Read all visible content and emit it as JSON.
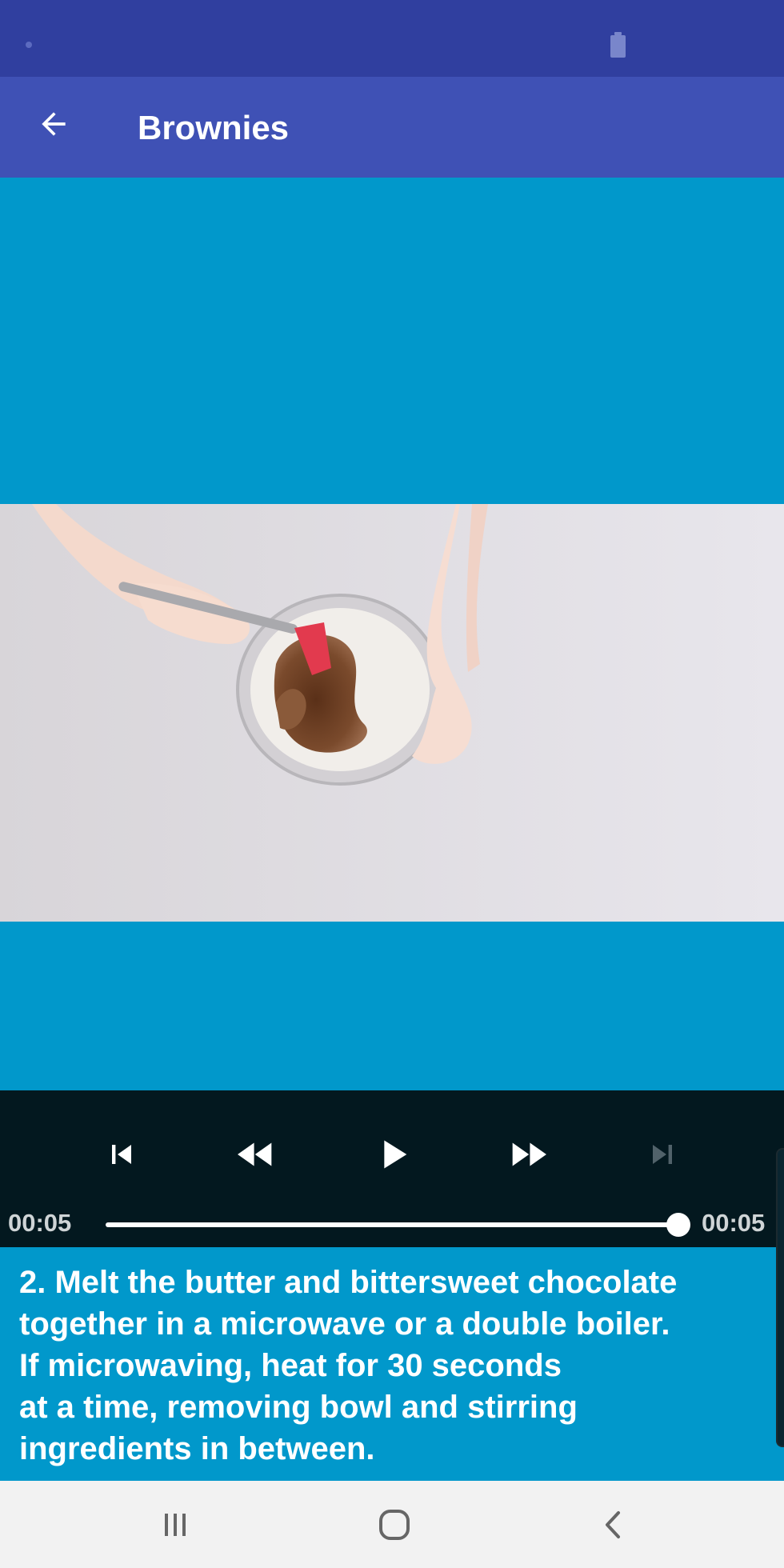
{
  "app": {
    "title": "Brownies"
  },
  "player": {
    "current_time": "00:05",
    "duration": "00:05",
    "progress": 1.0,
    "state": "paused",
    "next_disabled": true
  },
  "step": {
    "text": "2. Melt the butter and bittersweet chocolate\ntogether in a microwave or a double boiler.\nIf microwaving, heat for 30 seconds\nat a time, removing bowl and stirring\ningredients in between."
  },
  "icons": {
    "back": "arrow-left-icon",
    "previous": "skip-previous-icon",
    "rewind": "rewind-icon",
    "play": "play-icon",
    "forward": "fast-forward-icon",
    "next": "skip-next-icon",
    "recents": "recent-apps-icon",
    "home": "home-icon",
    "nav_back": "chevron-left-icon"
  },
  "colors": {
    "status_bar": "#303f9f",
    "app_bar": "#3f51b5",
    "video_background": "#0198cb",
    "controls_background": "#03181f",
    "nav_bar": "#f2f2f2"
  }
}
